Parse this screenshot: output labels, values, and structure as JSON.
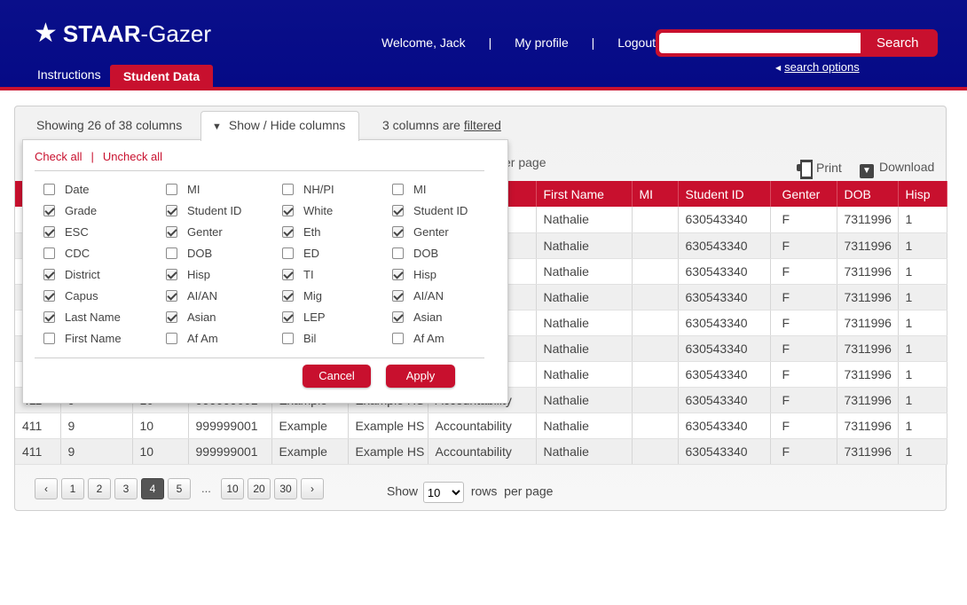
{
  "header": {
    "logo_bold": "STAAR",
    "logo_rest": "-Gazer",
    "welcome": "Welcome, Jack",
    "sep": "|",
    "profile": "My profile",
    "logout": "Logout",
    "search_value": "",
    "search_button": "Search",
    "search_options": "search options",
    "tab_instructions": "Instructions",
    "tab_student_data": "Student Data"
  },
  "toolbar": {
    "showing_text": "Showing 26 of 38 columns",
    "showhide_label": "Show / Hide columns",
    "filtered_prefix": "3 columns are ",
    "filtered_link": "filtered",
    "per_page_fragment": "er page",
    "print": "Print",
    "download": "Download"
  },
  "dropdown": {
    "check_all": "Check all",
    "sep": "|",
    "uncheck_all": "Uncheck all",
    "columns": [
      [
        {
          "label": "Date",
          "checked": false
        },
        {
          "label": "Grade",
          "checked": true
        },
        {
          "label": "ESC",
          "checked": true
        },
        {
          "label": "CDC",
          "checked": false
        },
        {
          "label": "District",
          "checked": true
        },
        {
          "label": "Capus",
          "checked": true
        },
        {
          "label": "Last Name",
          "checked": true
        },
        {
          "label": "First Name",
          "checked": false
        }
      ],
      [
        {
          "label": "MI",
          "checked": false
        },
        {
          "label": "Student ID",
          "checked": true
        },
        {
          "label": "Genter",
          "checked": true
        },
        {
          "label": "DOB",
          "checked": false
        },
        {
          "label": "Hisp",
          "checked": true
        },
        {
          "label": "AI/AN",
          "checked": true
        },
        {
          "label": "Asian",
          "checked": true
        },
        {
          "label": "Af Am",
          "checked": false
        }
      ],
      [
        {
          "label": "NH/PI",
          "checked": false
        },
        {
          "label": "White",
          "checked": true
        },
        {
          "label": "Eth",
          "checked": true
        },
        {
          "label": "ED",
          "checked": false
        },
        {
          "label": "TI",
          "checked": true
        },
        {
          "label": "Mig",
          "checked": true
        },
        {
          "label": "LEP",
          "checked": true
        },
        {
          "label": "Bil",
          "checked": false
        }
      ],
      [
        {
          "label": "MI",
          "checked": false
        },
        {
          "label": "Student ID",
          "checked": true
        },
        {
          "label": "Genter",
          "checked": true
        },
        {
          "label": "DOB",
          "checked": false
        },
        {
          "label": "Hisp",
          "checked": true
        },
        {
          "label": "AI/AN",
          "checked": true
        },
        {
          "label": "Asian",
          "checked": true
        },
        {
          "label": "Af Am",
          "checked": false
        }
      ]
    ],
    "cancel": "Cancel",
    "apply": "Apply"
  },
  "table": {
    "headers": [
      "",
      "",
      "",
      "",
      "",
      "",
      "",
      "First Name",
      "MI",
      "Student ID",
      "Genter",
      "DOB",
      "Hisp"
    ],
    "rows": [
      [
        "",
        "",
        "",
        "",
        "",
        "",
        "",
        "Nathalie",
        "",
        "630543340",
        "F",
        "7311996",
        "1"
      ],
      [
        "",
        "",
        "",
        "",
        "",
        "",
        "",
        "Nathalie",
        "",
        "630543340",
        "F",
        "7311996",
        "1"
      ],
      [
        "",
        "",
        "",
        "",
        "",
        "",
        "",
        "Nathalie",
        "",
        "630543340",
        "F",
        "7311996",
        "1"
      ],
      [
        "",
        "",
        "",
        "",
        "",
        "",
        "",
        "Nathalie",
        "",
        "630543340",
        "F",
        "7311996",
        "1"
      ],
      [
        "",
        "",
        "",
        "",
        "",
        "",
        "",
        "Nathalie",
        "",
        "630543340",
        "F",
        "7311996",
        "1"
      ],
      [
        "",
        "",
        "",
        "",
        "",
        "",
        "",
        "Nathalie",
        "",
        "630543340",
        "F",
        "7311996",
        "1"
      ],
      [
        "",
        "",
        "",
        "",
        "",
        "",
        "",
        "Nathalie",
        "",
        "630543340",
        "F",
        "7311996",
        "1"
      ],
      [
        "411",
        "9",
        "10",
        "999999001",
        "Example",
        "Example HS",
        "Accountability",
        "Nathalie",
        "",
        "630543340",
        "F",
        "7311996",
        "1"
      ],
      [
        "411",
        "9",
        "10",
        "999999001",
        "Example",
        "Example HS",
        "Accountability",
        "Nathalie",
        "",
        "630543340",
        "F",
        "7311996",
        "1"
      ],
      [
        "411",
        "9",
        "10",
        "999999001",
        "Example",
        "Example HS",
        "Accountability",
        "Nathalie",
        "",
        "630543340",
        "F",
        "7311996",
        "1"
      ]
    ]
  },
  "pagination": {
    "prev": "‹",
    "pages": [
      "1",
      "2",
      "3",
      "4",
      "5"
    ],
    "current": "4",
    "ellipsis": "...",
    "more_pages": [
      "10",
      "20",
      "30"
    ],
    "next": "›",
    "show": "Show",
    "rows_value": "10",
    "rows": "rows",
    "per_page": "per page"
  },
  "colors": {
    "header_blue": "#050a86",
    "accent_red": "#c8102e"
  }
}
